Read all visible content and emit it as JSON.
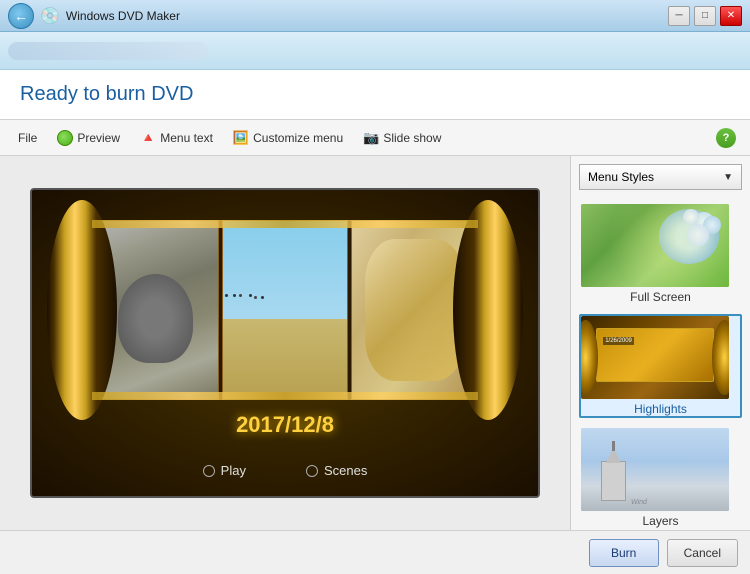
{
  "titlebar": {
    "title": "Windows DVD Maker",
    "min_label": "─",
    "max_label": "□",
    "close_label": "✕"
  },
  "header": {
    "title": "Ready to burn DVD"
  },
  "toolbar": {
    "file_label": "File",
    "preview_label": "Preview",
    "menu_text_label": "Menu text",
    "customize_menu_label": "Customize menu",
    "slide_show_label": "Slide show",
    "help_label": "?"
  },
  "dvd_preview": {
    "date": "2017/12/8",
    "play_label": "Play",
    "scenes_label": "Scenes"
  },
  "right_panel": {
    "dropdown_label": "Menu Styles",
    "styles": [
      {
        "id": "full-screen",
        "label": "Full Screen",
        "selected": false
      },
      {
        "id": "highlights",
        "label": "Highlights",
        "selected": true
      },
      {
        "id": "layers",
        "label": "Layers",
        "selected": false
      }
    ]
  },
  "bottom_bar": {
    "burn_label": "Burn",
    "cancel_label": "Cancel"
  }
}
